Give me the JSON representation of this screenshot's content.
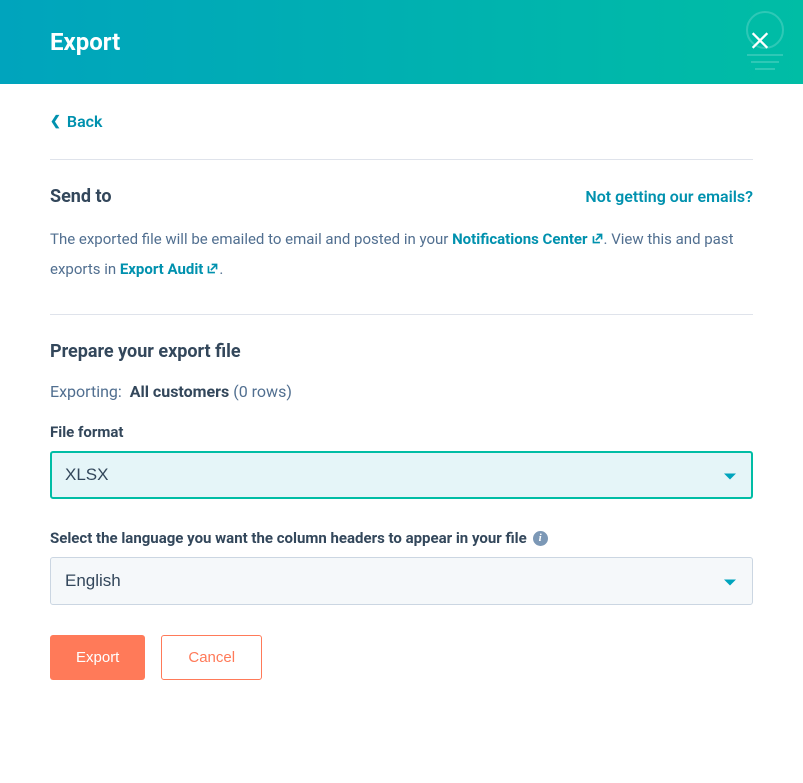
{
  "header": {
    "title": "Export"
  },
  "back": {
    "label": "Back"
  },
  "send_to": {
    "heading": "Send to",
    "help_link": "Not getting our emails?",
    "desc_pre": "The exported file will be emailed to email and posted in your ",
    "notifications_link": "Notifications Center",
    "desc_mid": ". View this and past exports in ",
    "export_audit_link": "Export Audit",
    "desc_post": "."
  },
  "prepare": {
    "heading": "Prepare your export file",
    "exporting_label": "Exporting:",
    "exporting_value": "All customers",
    "exporting_rows": "(0 rows)"
  },
  "file_format": {
    "label": "File format",
    "value": "XLSX"
  },
  "language": {
    "label": "Select the language you want the column headers to appear in your file",
    "value": "English"
  },
  "buttons": {
    "export": "Export",
    "cancel": "Cancel"
  }
}
